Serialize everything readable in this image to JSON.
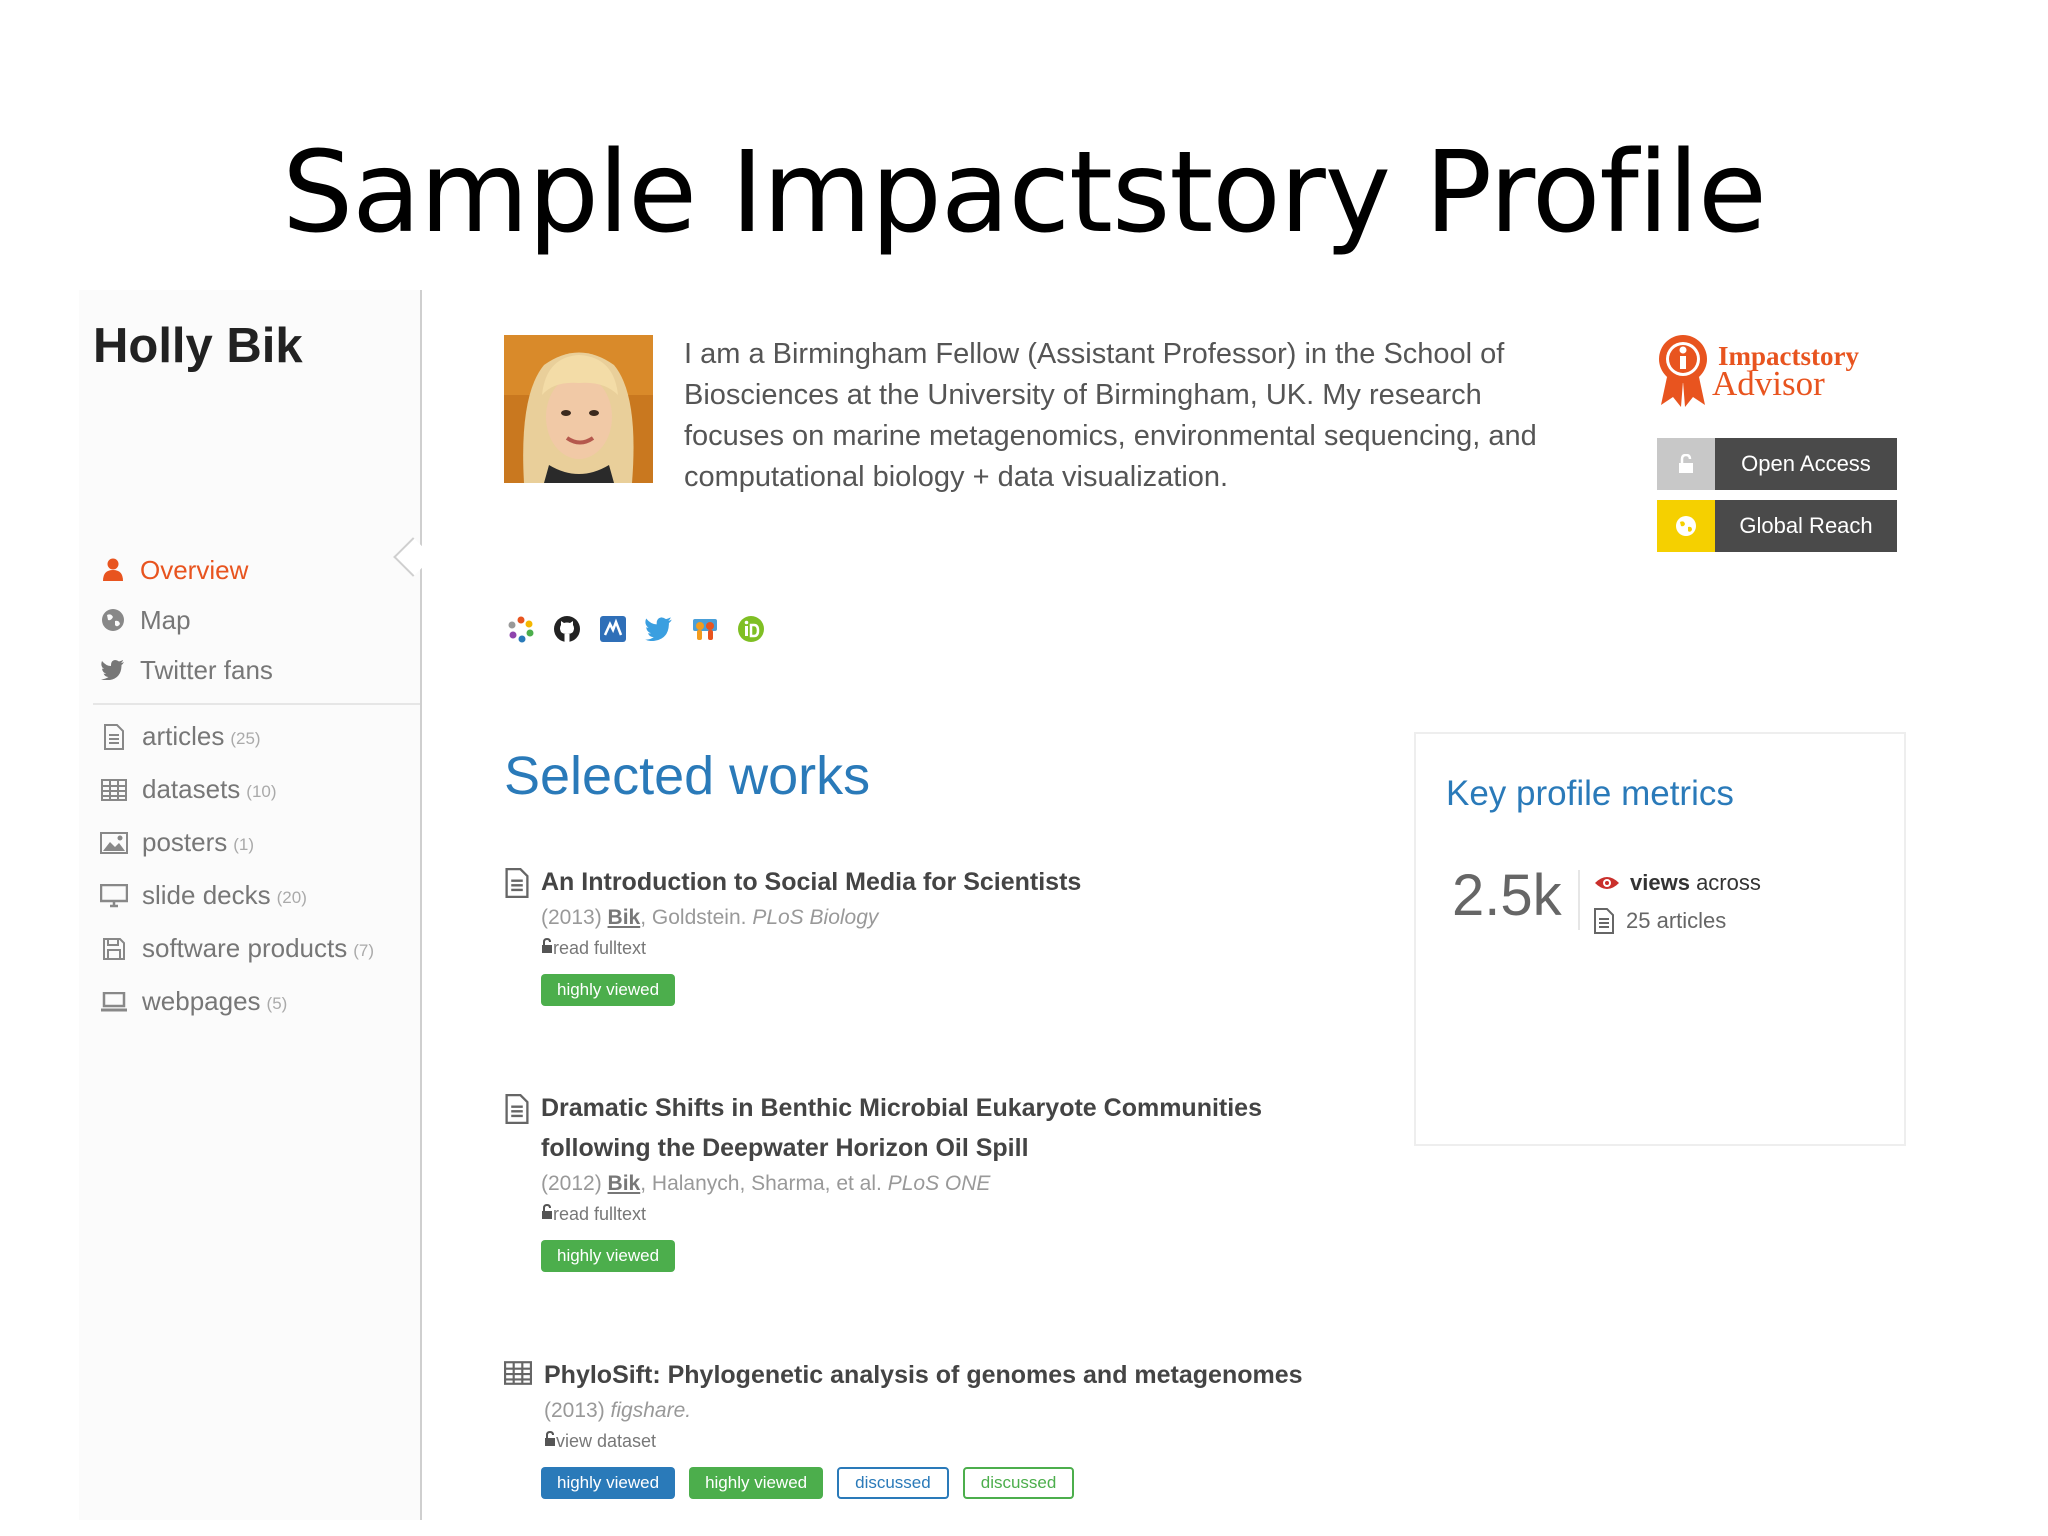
{
  "slide": {
    "title": "Sample Impactstory Profile"
  },
  "profile": {
    "name": "Holly Bik",
    "bio": "I am a Birmingham Fellow (Assistant Professor) in the School of Biosciences at the University of Birmingham, UK. My research focuses on marine metagenomics, environmental sequencing, and computational biology + data visualization."
  },
  "nav": {
    "overview": "Overview",
    "map": "Map",
    "twitter": "Twitter fans"
  },
  "categories": [
    {
      "label": "articles",
      "count": "(25)",
      "icon": "document-icon"
    },
    {
      "label": "datasets",
      "count": "(10)",
      "icon": "table-icon"
    },
    {
      "label": "posters",
      "count": "(1)",
      "icon": "image-icon"
    },
    {
      "label": "slide decks",
      "count": "(20)",
      "icon": "monitor-icon"
    },
    {
      "label": "software products",
      "count": "(7)",
      "icon": "floppy-disk-icon"
    },
    {
      "label": "webpages",
      "count": "(5)",
      "icon": "laptop-icon"
    }
  ],
  "advisor": {
    "line1": "Impactstory",
    "line2": "Advisor"
  },
  "awards": [
    {
      "label": "Open Access",
      "color": "#c8c8c8",
      "icon": "unlock-icon"
    },
    {
      "label": "Global Reach",
      "color": "#f5d000",
      "icon": "globe-icon"
    }
  ],
  "social_icons": [
    "impactstory-icon",
    "github-icon",
    "figshare-icon",
    "twitter-icon",
    "slideshare-icon",
    "orcid-icon"
  ],
  "selected_works": {
    "title": "Selected works",
    "items": [
      {
        "title": "An Introduction to Social Media for Scientists",
        "year": "(2013)",
        "author_me": "Bik",
        "authors_rest": ", Goldstein.",
        "venue": "PLoS Biology",
        "link": "read fulltext",
        "tags": [
          "highly viewed"
        ]
      },
      {
        "title_line1": "Dramatic Shifts in Benthic Microbial Eukaryote Communities",
        "title_line2": "following the Deepwater Horizon Oil Spill",
        "year": "(2012)",
        "author_me": "Bik",
        "authors_rest": ", Halanych, Sharma, et al.",
        "venue": "PLoS ONE",
        "link": "read fulltext",
        "tags": [
          "highly viewed"
        ]
      },
      {
        "title": "PhyloSift: Phylogenetic analysis of genomes and metagenomes",
        "year": "(2013)",
        "venue": "figshare.",
        "link": "view dataset",
        "tags": [
          "highly viewed",
          "highly viewed",
          "discussed",
          "discussed"
        ]
      }
    ]
  },
  "metrics": {
    "title": "Key profile metrics",
    "value": "2.5k",
    "views_word": "views",
    "across": "across",
    "articles": "25 articles"
  },
  "colors": {
    "accent": "#e8541f",
    "link_blue": "#2a7ab9",
    "green": "#4cae4c"
  }
}
